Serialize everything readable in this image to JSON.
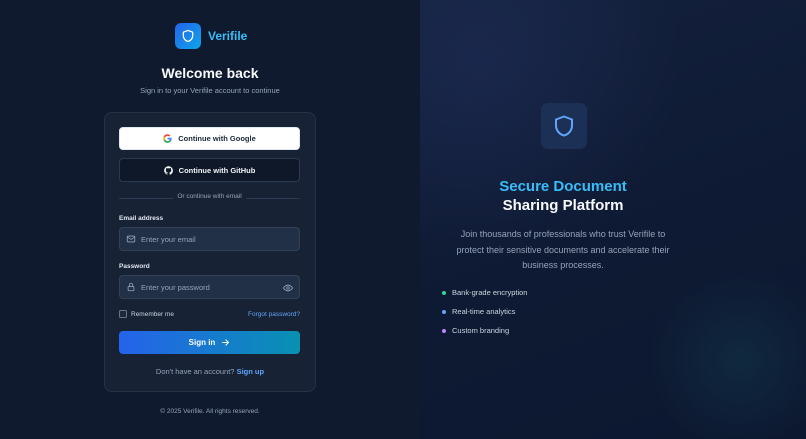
{
  "brand": {
    "name": "Verifile"
  },
  "login": {
    "title": "Welcome back",
    "subtitle": "Sign in to your Verifile account to continue",
    "google_label": "Continue with Google",
    "github_label": "Continue with GitHub",
    "divider_text": "Or continue with email",
    "email_label": "Email address",
    "email_placeholder": "Enter your email",
    "email_value": "",
    "password_label": "Password",
    "password_placeholder": "Enter your password",
    "password_value": "",
    "remember_label": "Remember me",
    "remember_checked": false,
    "forgot_label": "Forgot password?",
    "signin_label": "Sign in",
    "no_account_text": "Don't have an account?",
    "signup_label": "Sign up"
  },
  "footer": {
    "text": "© 2025 Verifile. All rights reserved."
  },
  "hero": {
    "title_line1": "Secure Document",
    "title_line2": "Sharing Platform",
    "description": "Join thousands of professionals who trust Verifile to protect their sensitive documents and accelerate their business processes.",
    "features": [
      {
        "label": "Bank-grade encryption",
        "color": "#34d399"
      },
      {
        "label": "Real-time analytics",
        "color": "#60a5fa"
      },
      {
        "label": "Custom branding",
        "color": "#c084fc"
      }
    ]
  },
  "colors": {
    "accent": "#38bdf8",
    "link": "#60a5fa",
    "button_gradient_start": "#2563eb",
    "button_gradient_end": "#0891b2"
  },
  "icons": [
    "shield-icon",
    "google-icon",
    "github-icon",
    "mail-icon",
    "lock-icon",
    "eye-icon",
    "arrow-right-icon"
  ]
}
